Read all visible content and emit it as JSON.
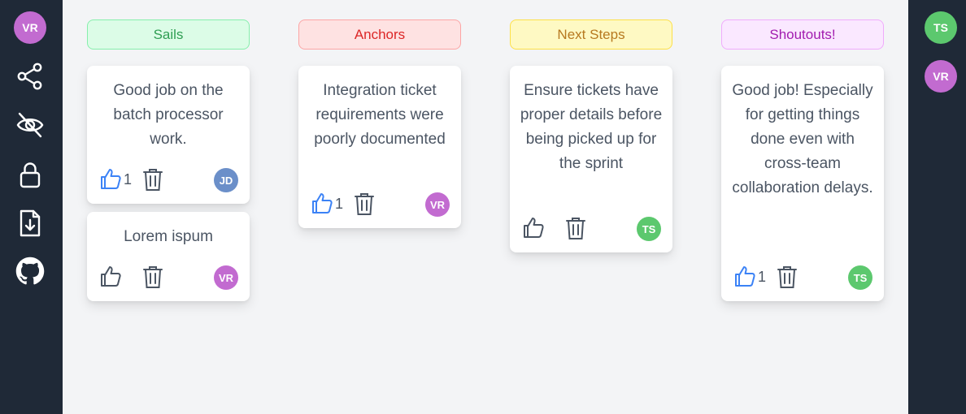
{
  "sidebar": {
    "user_initials": "VR",
    "user_color": "#c26bd0",
    "icons": [
      "share-icon",
      "eye-off-icon",
      "lock-icon",
      "download-file-icon",
      "github-icon"
    ]
  },
  "participants": [
    {
      "initials": "TS",
      "color": "#5cc86e"
    },
    {
      "initials": "VR",
      "color": "#c26bd0"
    }
  ],
  "columns": [
    {
      "title": "Sails",
      "text_color": "#2f9e53",
      "bg_color": "#dcfce7",
      "border_color": "#86efac",
      "cards": [
        {
          "text": "Good job on the batch processor work.",
          "likes": "1",
          "liked": true,
          "author_initials": "JD",
          "author_color": "#6b8fc9"
        },
        {
          "text": "Lorem ispum",
          "likes": "",
          "liked": false,
          "author_initials": "VR",
          "author_color": "#c26bd0"
        }
      ]
    },
    {
      "title": "Anchors",
      "text_color": "#dc2626",
      "bg_color": "#fee2e2",
      "border_color": "#fca5a5",
      "cards": [
        {
          "text": "Integration ticket requirements were poorly documented",
          "likes": "1",
          "liked": true,
          "author_initials": "VR",
          "author_color": "#c26bd0"
        }
      ]
    },
    {
      "title": "Next Steps",
      "text_color": "#b7791f",
      "bg_color": "#fef9c3",
      "border_color": "#fde047",
      "cards": [
        {
          "text": "Ensure tickets have proper details before being picked up for the sprint",
          "likes": "",
          "liked": false,
          "author_initials": "TS",
          "author_color": "#5cc86e"
        }
      ]
    },
    {
      "title": "Shoutouts!",
      "text_color": "#a21caf",
      "bg_color": "#fae8ff",
      "border_color": "#f0abfc",
      "cards": [
        {
          "text": "Good job! Especially for getting things done even with cross-team collaboration delays.",
          "likes": "1",
          "liked": true,
          "author_initials": "TS",
          "author_color": "#5cc86e"
        }
      ]
    }
  ]
}
